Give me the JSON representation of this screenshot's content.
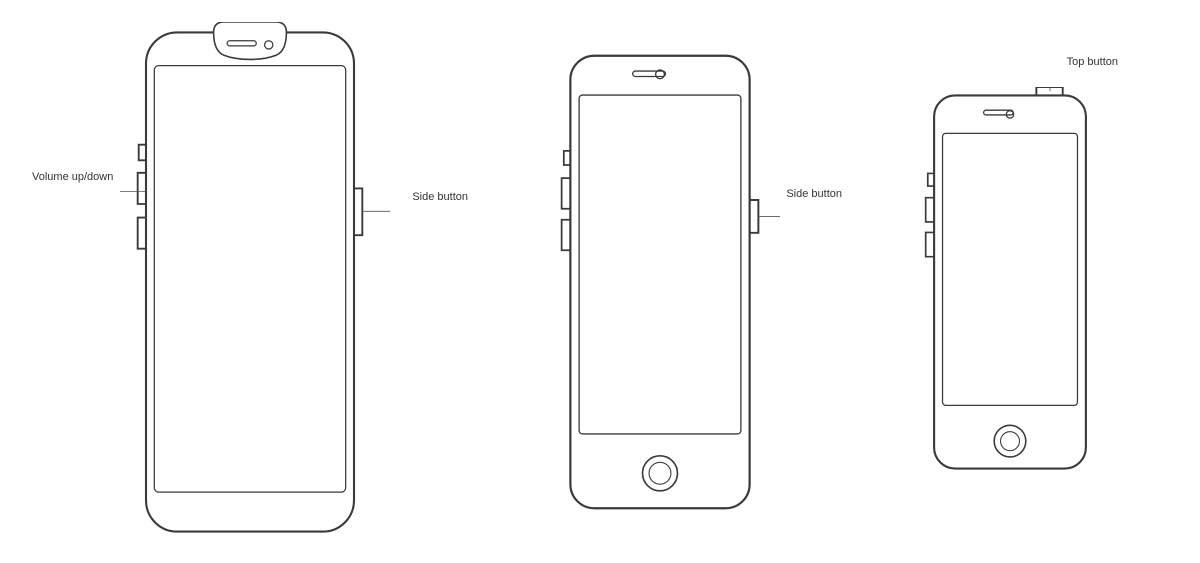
{
  "labels": {
    "phone1": {
      "volume": "Volume\nup/down",
      "side": "Side\nbutton"
    },
    "phone2": {
      "side": "Side\nbutton"
    },
    "phone3": {
      "top": "Top button"
    }
  },
  "colors": {
    "stroke": "#3a3a3a",
    "background": "#ffffff",
    "label_text": "#333333"
  }
}
